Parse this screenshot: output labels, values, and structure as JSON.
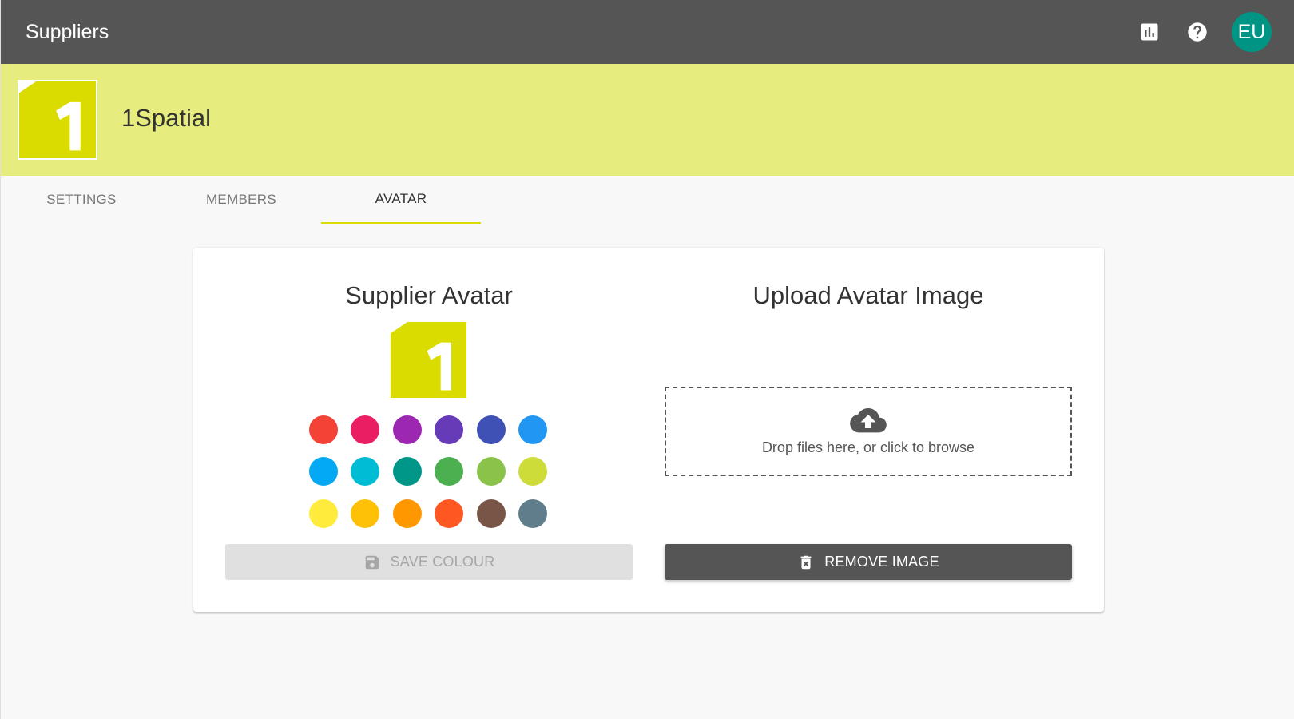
{
  "topbar": {
    "title": "Suppliers",
    "icons": [
      "bar-chart-icon",
      "help-icon"
    ],
    "user_initials": "EU"
  },
  "supplier": {
    "name": "1Spatial",
    "logo_color": "#dadc00",
    "banner_color": "#e6ec7d"
  },
  "tabs": [
    {
      "label": "SETTINGS",
      "active": false
    },
    {
      "label": "MEMBERS",
      "active": false
    },
    {
      "label": "AVATAR",
      "active": true
    }
  ],
  "avatar_panel": {
    "title": "Supplier Avatar",
    "colours": [
      "#f44336",
      "#e91e63",
      "#9c27b0",
      "#673ab7",
      "#3f51b5",
      "#2196f3",
      "#03a9f4",
      "#00bcd4",
      "#009688",
      "#4caf50",
      "#8bc34a",
      "#cddc39",
      "#ffeb3b",
      "#ffc107",
      "#ff9800",
      "#ff5722",
      "#795548",
      "#607d8b"
    ],
    "save_label": "SAVE COLOUR",
    "save_enabled": false
  },
  "upload_panel": {
    "title": "Upload Avatar Image",
    "dropzone_text": "Drop files here, or click to browse",
    "remove_label": "REMOVE IMAGE"
  }
}
